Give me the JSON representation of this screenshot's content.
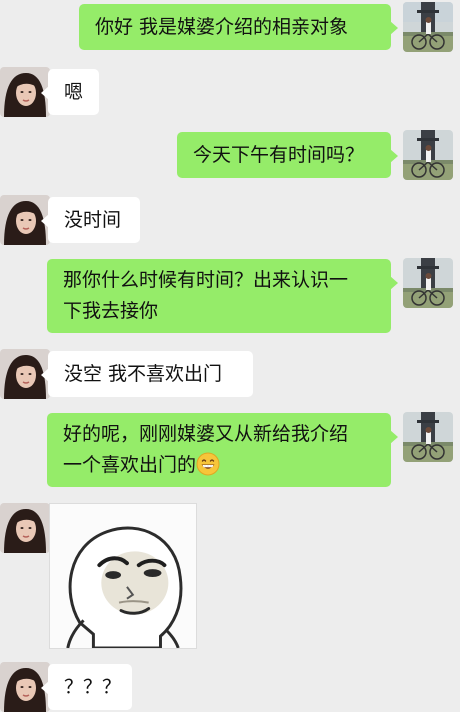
{
  "colors": {
    "background": "#ededed",
    "my_bubble": "#95ec69",
    "their_bubble": "#ffffff"
  },
  "messages": [
    {
      "sender": "me",
      "text": "你好 我是媒婆介绍的相亲对象"
    },
    {
      "sender": "them",
      "text": "嗯"
    },
    {
      "sender": "me",
      "text": "今天下午有时间吗？"
    },
    {
      "sender": "them",
      "text": "没时间"
    },
    {
      "sender": "me",
      "lines": [
        "那你什么时候有时间？出来认识一",
        "下我去接你"
      ]
    },
    {
      "sender": "them",
      "text": "没空 我不喜欢出门"
    },
    {
      "sender": "me",
      "lines": [
        "好的呢，刚刚媒婆又从新给我介绍",
        "一个喜欢出门的"
      ],
      "emoji": "grinning-emoji"
    },
    {
      "sender": "them",
      "type": "sticker",
      "sticker": "panda-face-meme-sticker"
    },
    {
      "sender": "them",
      "text": "？？？"
    }
  ],
  "avatars": {
    "me": "cyclist-photo-avatar",
    "them": "woman-portrait-avatar"
  }
}
